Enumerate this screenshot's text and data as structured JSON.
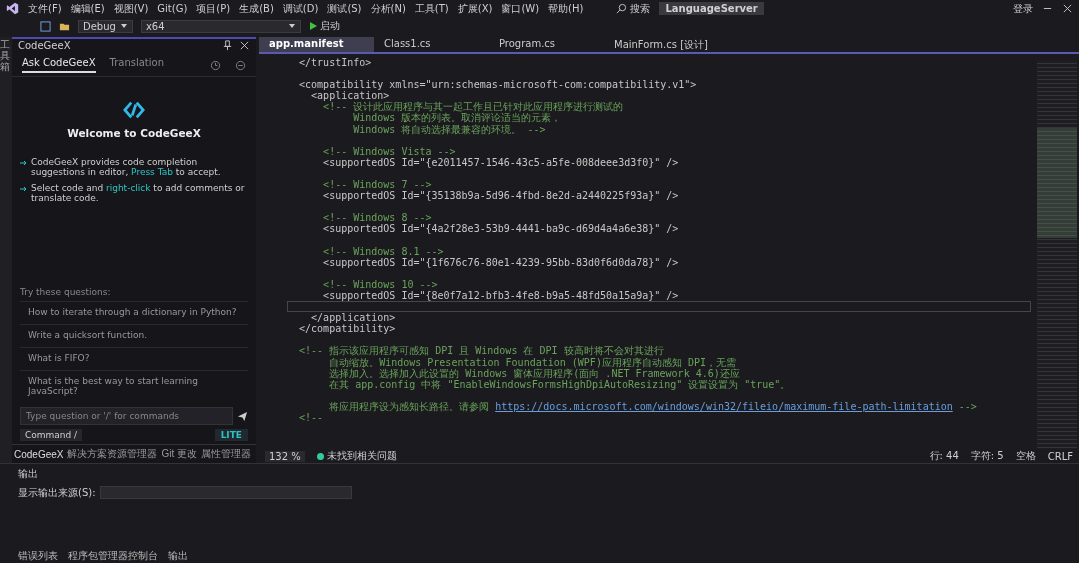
{
  "menu": [
    "文件(F)",
    "编辑(E)",
    "视图(V)",
    "Git(G)",
    "项目(P)",
    "生成(B)",
    "调试(D)",
    "测试(S)",
    "分析(N)",
    "工具(T)",
    "扩展(X)",
    "窗口(W)",
    "帮助(H)"
  ],
  "search": {
    "label": "搜索"
  },
  "solution_name": "LanguageServer",
  "sign_in": "登录",
  "toolbar": {
    "configuration": "Debug",
    "platform": "x64",
    "start": "启动"
  },
  "side_strip": {
    "label": "工具箱"
  },
  "codegeex": {
    "title": "CodeGeeX",
    "tabs": [
      {
        "label": "Ask CodeGeeX",
        "selected": true
      },
      {
        "label": "Translation",
        "selected": false
      }
    ],
    "welcome": "Welcome to CodeGeeX",
    "tips": [
      {
        "text": "CodeGeeX provides code completion suggestions in editor, ",
        "link": "Press Tab",
        "after": " to accept."
      },
      {
        "text": "Select code and ",
        "link": "right-click",
        "after": " to add comments or translate code."
      }
    ],
    "questions_title": "Try these questions:",
    "questions": [
      "How to iterate through a dictionary in Python?",
      "Write a quicksort function.",
      "What is FIFO?",
      "What is the best way to start learning JavaScript?"
    ],
    "input": {
      "placeholder": "Type question or '/' for commands"
    },
    "command": "Command /",
    "mode": "LITE"
  },
  "editor_tabs": [
    {
      "label": "app.manifest",
      "selected": true
    },
    {
      "label": "Class1.cs",
      "selected": false
    },
    {
      "label": "Program.cs",
      "selected": false
    },
    {
      "label": "MainForm.cs [设计]",
      "selected": false
    }
  ],
  "code_lines": [
    {
      "kind": "tag",
      "text": "  </trustInfo>"
    },
    {
      "kind": "blank"
    },
    {
      "kind": "tag",
      "text": "  <compatibility xmlns=\"urn:schemas-microsoft-com:compatibility.v1\">"
    },
    {
      "kind": "tag",
      "text": "    <application>"
    },
    {
      "kind": "comment",
      "text": "      <!-- 设计此应用程序与其一起工作且已针对此应用程序进行测试的"
    },
    {
      "kind": "comment",
      "text": "           Windows 版本的列表。取消评论适当的元素，"
    },
    {
      "kind": "comment",
      "text": "           Windows 将自动选择最兼容的环境。 -->"
    },
    {
      "kind": "blank"
    },
    {
      "kind": "comment",
      "text": "      <!-- Windows Vista -->"
    },
    {
      "kind": "tag",
      "text": "      <supportedOS Id=\"{e2011457-1546-43c5-a5fe-008deee3d3f0}\" />"
    },
    {
      "kind": "blank"
    },
    {
      "kind": "comment",
      "text": "      <!-- Windows 7 -->"
    },
    {
      "kind": "tag",
      "text": "      <supportedOS Id=\"{35138b9a-5d96-4fbd-8e2d-a2440225f93a}\" />"
    },
    {
      "kind": "blank"
    },
    {
      "kind": "comment",
      "text": "      <!-- Windows 8 -->"
    },
    {
      "kind": "tag",
      "text": "      <supportedOS Id=\"{4a2f28e3-53b9-4441-ba9c-d69d4a4a6e38}\" />"
    },
    {
      "kind": "blank"
    },
    {
      "kind": "comment",
      "text": "      <!-- Windows 8.1 -->"
    },
    {
      "kind": "tag",
      "text": "      <supportedOS Id=\"{1f676c76-80e1-4239-95bb-83d0f6d0da78}\" />"
    },
    {
      "kind": "blank"
    },
    {
      "kind": "comment",
      "text": "      <!-- Windows 10 -->"
    },
    {
      "kind": "tag",
      "text": "      <supportedOS Id=\"{8e0f7a12-bfb3-4fe8-b9a5-48fd50a15a9a}\" />"
    },
    {
      "kind": "current"
    },
    {
      "kind": "tag",
      "text": "    </application>"
    },
    {
      "kind": "tag",
      "text": "  </compatibility>"
    },
    {
      "kind": "blank"
    },
    {
      "kind": "comment",
      "text": "  <!-- 指示该应用程序可感知 DPI 且 Windows 在 DPI 较高时将不会对其进行"
    },
    {
      "kind": "comment",
      "text": "       自动缩放。Windows Presentation Foundation (WPF)应用程序自动感知 DPI，无需"
    },
    {
      "kind": "comment",
      "text": "       选择加入。选择加入此设置的 Windows 窗体应用程序(面向 .NET Framework 4.6)还应"
    },
    {
      "kind": "comment",
      "text": "       在其 app.config 中将 \"EnableWindowsFormsHighDpiAutoResizing\" 设置设置为 \"true\"。"
    },
    {
      "kind": "blank"
    },
    {
      "kind": "comment",
      "text": "       将应用程序设为感知长路径。请参阅 ",
      "link": "https://docs.microsoft.com/windows/win32/fileio/maximum-file-path-limitation",
      "after": " -->"
    },
    {
      "kind": "comment",
      "text": "  <!--"
    }
  ],
  "editor_status": {
    "zoom": "132 %",
    "issues": "未找到相关问题",
    "line": "行: 44",
    "char": "字符: 5",
    "spaces": "空格",
    "eol": "CRLF"
  },
  "left_bottom_tabs": [
    {
      "label": "CodeGeeX",
      "selected": true
    },
    {
      "label": "解决方案资源管理器",
      "selected": false
    },
    {
      "label": "Git 更改",
      "selected": false
    },
    {
      "label": "属性管理器",
      "selected": false
    }
  ],
  "output": {
    "title": "输出",
    "source_label": "显示输出来源(S):"
  },
  "bottom_tabs": [
    "错误列表",
    "程序包管理器控制台",
    "输出"
  ]
}
